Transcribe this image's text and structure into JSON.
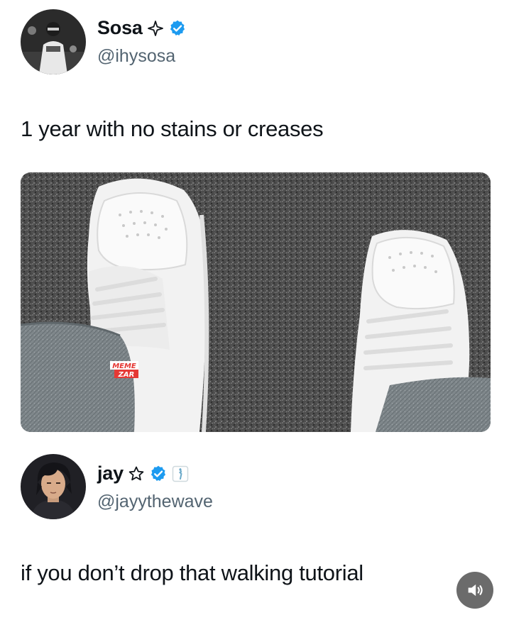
{
  "tweet": {
    "author": {
      "display_name": "Sosa",
      "handle": "@ihysosa",
      "verified": true,
      "name_symbol_icon": "four-point-star-icon"
    },
    "text": "1 year with no stains or creases",
    "media": {
      "watermark_lines": [
        "MEME",
        "ZAR"
      ]
    }
  },
  "reply": {
    "author": {
      "display_name": "jay",
      "handle": "@jayythewave",
      "verified": true,
      "name_symbol_icon": "outline-star-icon",
      "badge_icon": "affiliate-badge-icon"
    },
    "text": "if you don’t drop that walking tutorial"
  },
  "controls": {
    "sound_icon": "speaker-icon"
  },
  "colors": {
    "verified_blue": "#1d9bf0",
    "handle_gray": "#536471",
    "text": "#0f1419"
  }
}
